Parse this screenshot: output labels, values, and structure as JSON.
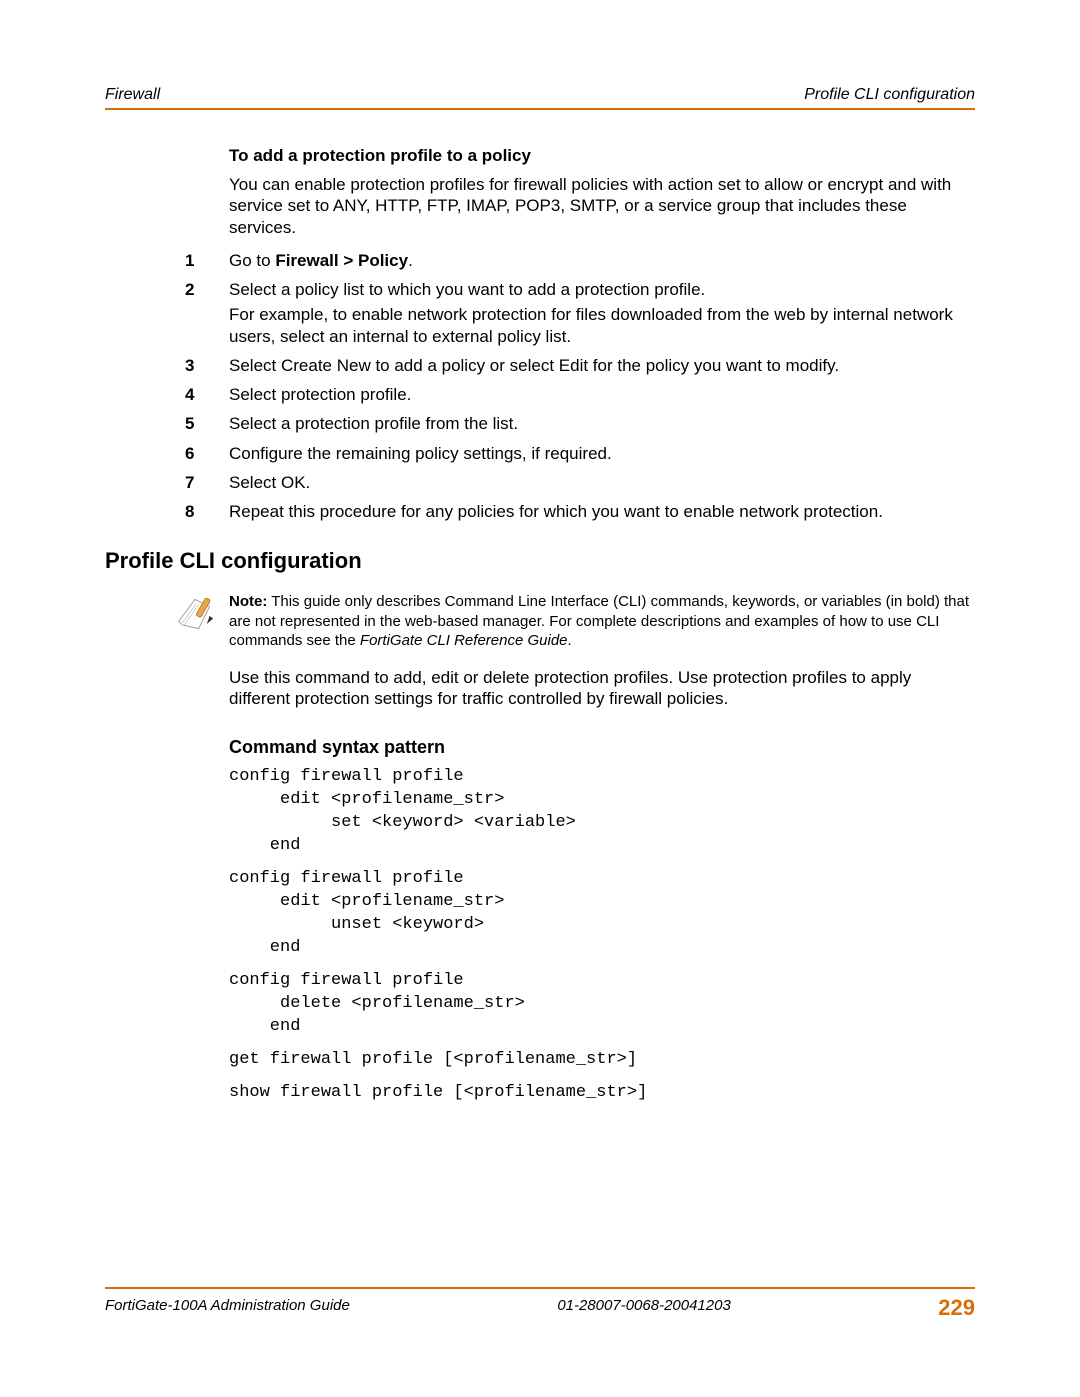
{
  "header": {
    "left": "Firewall",
    "right": "Profile CLI configuration"
  },
  "procedure": {
    "title": "To add a protection profile to a policy",
    "intro": "You can enable protection profiles for firewall policies with action set to allow or encrypt and with service set to ANY, HTTP, FTP, IMAP, POP3, SMTP, or a service group that includes these services.",
    "steps": [
      {
        "pre": "Go to ",
        "bold": "Firewall > Policy",
        "post": "."
      },
      {
        "main": "Select a policy list to which you want to add a protection profile.",
        "extra": "For example, to enable network protection for files downloaded from the web by internal network users, select an internal to external policy list."
      },
      {
        "main": "Select Create New to add a policy or select Edit for the policy you want to modify."
      },
      {
        "main": "Select protection profile."
      },
      {
        "main": "Select a protection profile from the list."
      },
      {
        "main": "Configure the remaining policy settings, if required."
      },
      {
        "main": "Select OK."
      },
      {
        "main": "Repeat this procedure for any policies for which you want to enable network protection."
      }
    ]
  },
  "cli": {
    "heading": "Profile CLI configuration",
    "note_lead": "Note:",
    "note_body_a": " This guide only describes Command Line Interface (CLI) commands, keywords, or variables (in bold) that are not represented in the web-based manager. For complete descriptions and examples of how to use CLI commands see the ",
    "note_italic": "FortiGate CLI Reference Guide",
    "note_body_b": ".",
    "intro": "Use this command to add, edit or delete protection profiles. Use protection profiles to apply different protection settings for traffic controlled by firewall policies.",
    "syntax_heading": "Command syntax pattern",
    "blocks": [
      "config firewall profile\n     edit <profilename_str>\n          set <keyword> <variable>\n    end",
      "config firewall profile\n     edit <profilename_str>\n          unset <keyword>\n    end",
      "config firewall profile\n     delete <profilename_str>\n    end",
      "get firewall profile [<profilename_str>]",
      "show firewall profile [<profilename_str>]"
    ]
  },
  "footer": {
    "left": "FortiGate-100A Administration Guide",
    "center": "01-28007-0068-20041203",
    "page": "229"
  }
}
